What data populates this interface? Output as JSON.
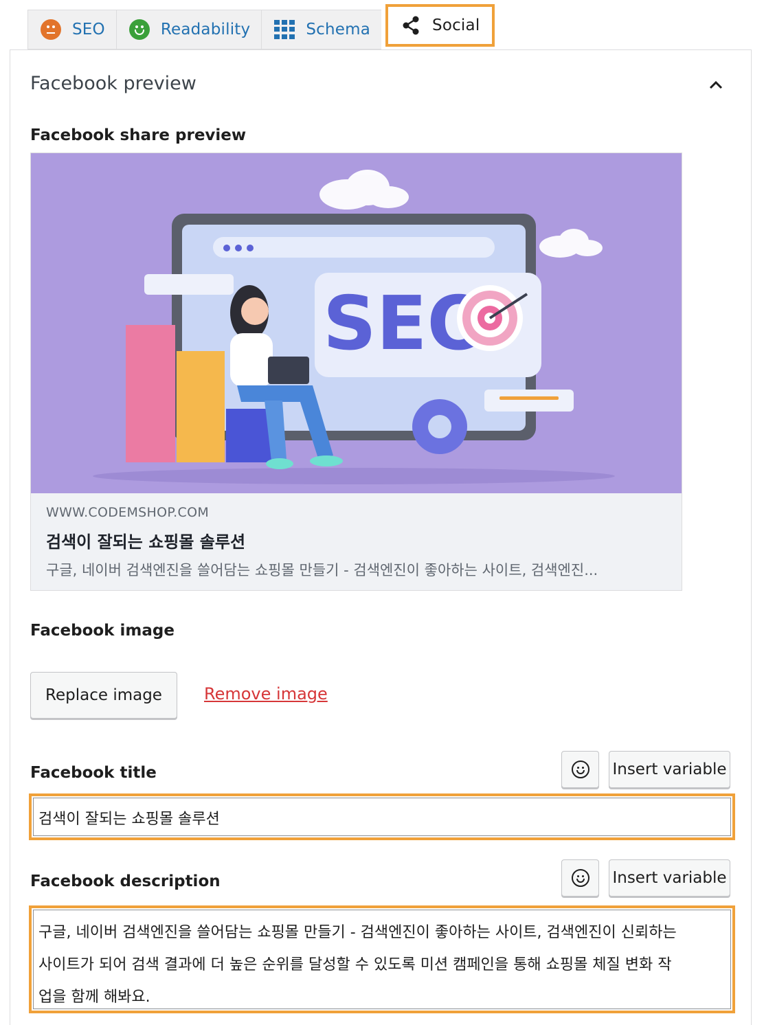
{
  "tabs": [
    {
      "label": "SEO",
      "icon": "neutral-face-icon",
      "active": false
    },
    {
      "label": "Readability",
      "icon": "smile-face-icon",
      "active": false
    },
    {
      "label": "Schema",
      "icon": "grid-icon",
      "active": false
    },
    {
      "label": "Social",
      "icon": "share-icon",
      "active": true
    }
  ],
  "section": {
    "title": "Facebook preview"
  },
  "share_preview": {
    "label": "Facebook share preview",
    "domain": "WWW.CODEMSHOP.COM",
    "title": "검색이 잘되는 쇼핑몰 솔루션",
    "description": "구글, 네이버 검색엔진을 쓸어담는 쇼핑몰 만들기 - 검색엔진이 좋아하는 사이트, 검색엔진...",
    "image_text": "SEO"
  },
  "image": {
    "label": "Facebook image",
    "replace_label": "Replace image",
    "remove_label": "Remove image"
  },
  "title_field": {
    "label": "Facebook title",
    "insert_variable_label": "Insert variable",
    "value": "검색이 잘되는 쇼핑몰 솔루션"
  },
  "description_field": {
    "label": "Facebook description",
    "insert_variable_label": "Insert variable",
    "value_lines": [
      "구글, 네이버 검색엔진을 쓸어담는 쇼핑몰 만들기 - 검색엔진이 좋아하는 사이트, 검색엔진이 신뢰하는",
      "사이트가 되어 검색 결과에 더 높은 순위를 달성할 수 있도록 미션 캠페인을 통해 쇼핑몰 체질 변화 작",
      "업을 함께 해봐요."
    ]
  },
  "colors": {
    "highlight": "#f0a13a",
    "link": "#2271b1",
    "remove_link": "#d63638",
    "seo_score": "#e2742b",
    "readability_score": "#3aa03a",
    "preview_bg": "#ad9bdf"
  }
}
